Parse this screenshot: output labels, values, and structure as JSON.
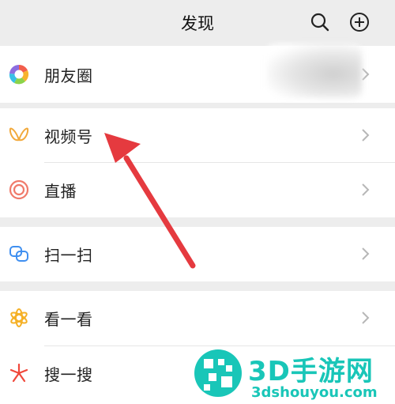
{
  "header": {
    "title": "发现",
    "search_icon": "search-icon",
    "add_icon": "plus-circle-icon"
  },
  "menu": {
    "items": [
      {
        "label": "朋友圈",
        "icon": "moments-aperture-icon"
      },
      {
        "label": "视频号",
        "icon": "channels-butterfly-icon"
      },
      {
        "label": "直播",
        "icon": "live-ring-icon"
      },
      {
        "label": "扫一扫",
        "icon": "scan-icon"
      },
      {
        "label": "看一看",
        "icon": "top-stories-icon"
      },
      {
        "label": "搜一搜",
        "icon": "search-star-icon"
      }
    ]
  },
  "colors": {
    "background": "#ededed",
    "arrow": "#e53a3f",
    "watermark": "#19c6b8"
  },
  "watermark": {
    "title": "3D手游网",
    "url": "3dshouyou.com"
  }
}
